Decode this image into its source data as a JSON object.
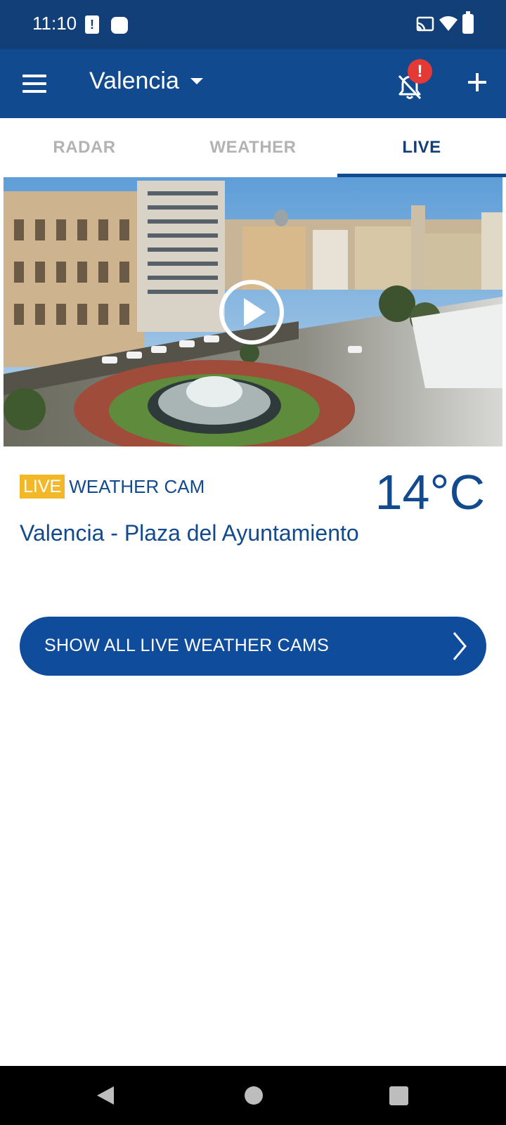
{
  "status_bar": {
    "time": "11:10",
    "sim_alert": "!"
  },
  "app_bar": {
    "location": "Valencia",
    "notification_badge": "!"
  },
  "tabs": [
    {
      "label": "RADAR",
      "active": false
    },
    {
      "label": "WEATHER",
      "active": false
    },
    {
      "label": "LIVE",
      "active": true
    }
  ],
  "cam": {
    "live_badge": "LIVE",
    "label": "WEATHER CAM",
    "temperature": "14°C",
    "title": "Valencia - Plaza del Ayuntamiento"
  },
  "show_all_button": {
    "label": "SHOW ALL LIVE WEATHER CAMS"
  },
  "colors": {
    "status_bar": "#123f78",
    "app_bar": "#124a8f",
    "accent_blue": "#0f4c9c",
    "live_badge": "#f3b829",
    "alert_red": "#e53935"
  }
}
